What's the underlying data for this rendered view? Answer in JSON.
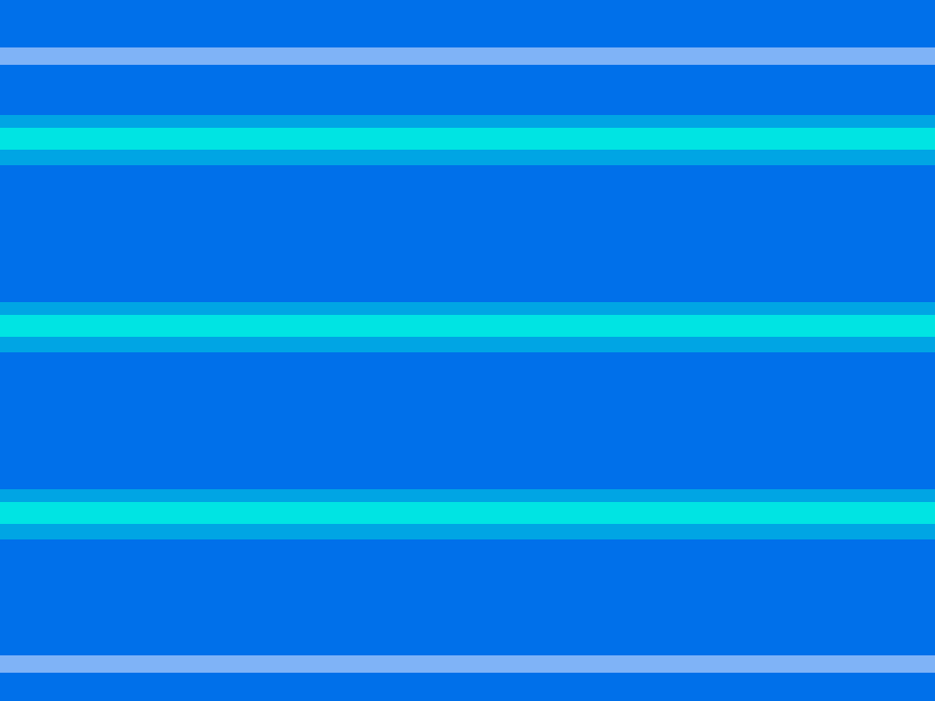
{
  "colors": {
    "background": "#0070ea",
    "pale_stripe": "#7fb3f7",
    "band_outer": "#00a5e4",
    "band_core": "#00e4e3"
  },
  "stripes": {
    "pale_count": 2,
    "glow_band_count": 3
  }
}
